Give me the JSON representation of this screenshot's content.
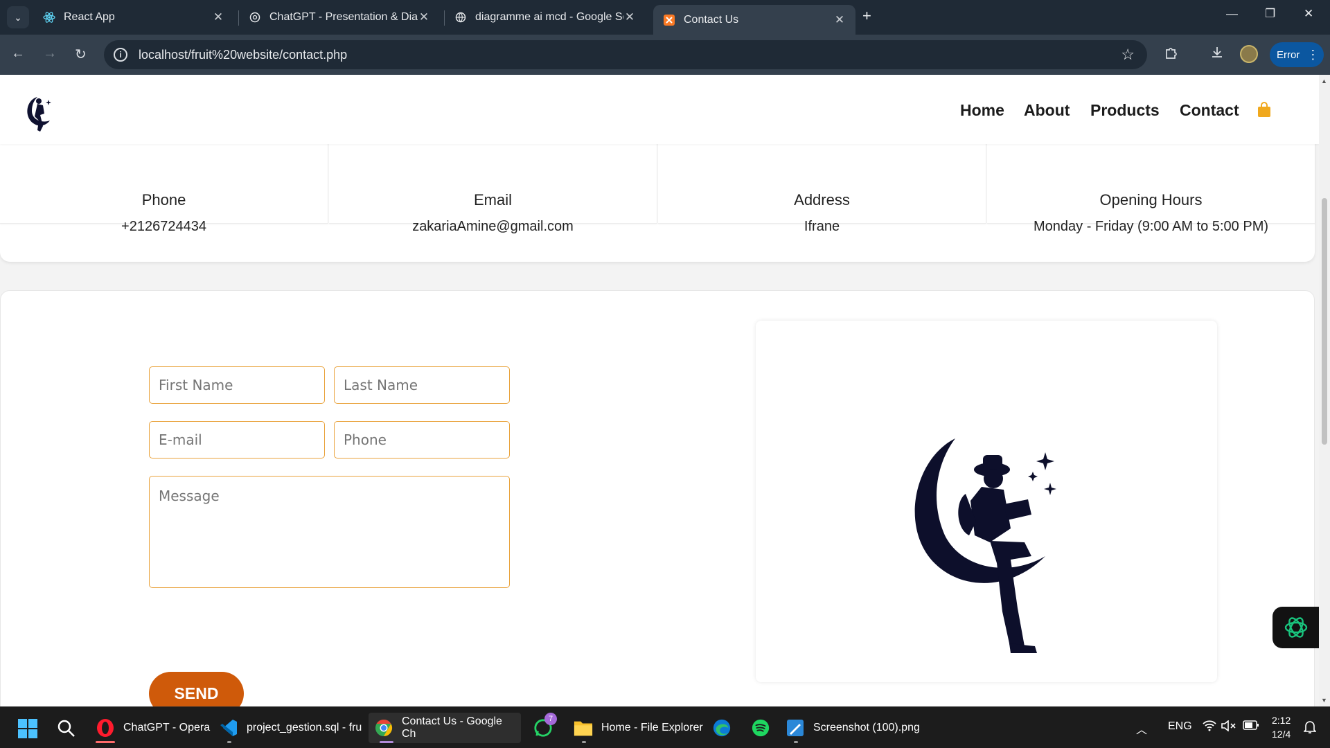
{
  "browser": {
    "tabs": [
      {
        "title": "React App",
        "icon": "react-icon"
      },
      {
        "title": "ChatGPT - Presentation & Diagr",
        "icon": "chatgpt-icon"
      },
      {
        "title": "diagramme ai mcd - Google Se",
        "icon": "globe-icon"
      },
      {
        "title": "Contact Us",
        "icon": "xampp-icon"
      }
    ],
    "active_tab": 3,
    "url": "localhost/fruit%20website/contact.php",
    "error_label": "Error"
  },
  "site": {
    "nav": [
      "Home",
      "About",
      "Products",
      "Contact"
    ],
    "accent": "#f0a81d",
    "info_cards": [
      {
        "label": "Phone",
        "value": "+2126724434"
      },
      {
        "label": "Email",
        "value": "zakariaAmine@gmail.com"
      },
      {
        "label": "Address",
        "value": "Ifrane"
      },
      {
        "label": "Opening Hours",
        "value": "Monday - Friday (9:00 AM to 5:00 PM)"
      }
    ],
    "form": {
      "first_name_placeholder": "First Name",
      "last_name_placeholder": "Last Name",
      "email_placeholder": "E-mail",
      "phone_placeholder": "Phone",
      "message_placeholder": "Message",
      "send_label": "SEND",
      "button_color": "#cf5a0a"
    }
  },
  "taskbar": {
    "apps": [
      {
        "label": "ChatGPT - Opera",
        "icon": "opera-icon"
      },
      {
        "label": "project_gestion.sql - fru",
        "icon": "vscode-icon"
      },
      {
        "label": "Contact Us - Google Ch",
        "icon": "chrome-icon"
      },
      {
        "label": "",
        "icon": "whatsapp-icon",
        "badge": "7"
      },
      {
        "label": "Home - File Explorer",
        "icon": "folder-icon"
      },
      {
        "label": "",
        "icon": "edge-icon"
      },
      {
        "label": "",
        "icon": "spotify-icon"
      },
      {
        "label": "Screenshot (100).png",
        "icon": "photos-icon"
      }
    ],
    "language": "ENG",
    "time": "2:12",
    "date": "12/4"
  }
}
